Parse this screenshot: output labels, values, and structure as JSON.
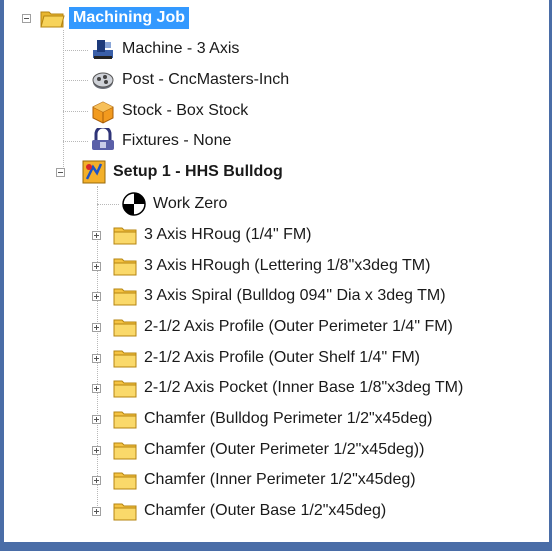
{
  "tree": {
    "root": {
      "label": "Machining Job",
      "icon": "machining-job-folder-icon",
      "expanded": true,
      "selected": true
    },
    "items": [
      {
        "label": "Machine - 3 Axis",
        "icon": "machine-icon"
      },
      {
        "label": "Post - CncMasters-Inch",
        "icon": "post-icon"
      },
      {
        "label": "Stock - Box Stock",
        "icon": "stock-box-icon"
      },
      {
        "label": "Fixtures - None",
        "icon": "fixtures-icon"
      }
    ],
    "setup": {
      "label": "Setup 1 - HHS Bulldog",
      "icon": "setup-icon",
      "expanded": true,
      "work_zero": {
        "label": "Work Zero",
        "icon": "work-zero-icon"
      },
      "operations": [
        {
          "label": "3 Axis HRoug (1/4\" FM)"
        },
        {
          "label": "3 Axis HRough (Lettering 1/8\"x3deg TM)"
        },
        {
          "label": "3 Axis Spiral (Bulldog 094\" Dia x 3deg TM)"
        },
        {
          "label": "2-1/2 Axis Profile (Outer Perimeter 1/4\" FM)"
        },
        {
          "label": "2-1/2 Axis Profile (Outer Shelf 1/4\" FM)"
        },
        {
          "label": "2-1/2 Axis Pocket (Inner Base 1/8\"x3deg TM)"
        },
        {
          "label": "Chamfer (Bulldog Perimeter 1/2\"x45deg)"
        },
        {
          "label": "Chamfer (Outer Perimeter 1/2\"x45deg))"
        },
        {
          "label": "Chamfer (Inner Perimeter 1/2\"x45deg)"
        },
        {
          "label": "Chamfer (Outer Base  1/2\"x45deg)"
        }
      ]
    }
  },
  "colors": {
    "selection": "#3399ff",
    "frame": "#4a6da7",
    "folder": "#f5c342"
  }
}
